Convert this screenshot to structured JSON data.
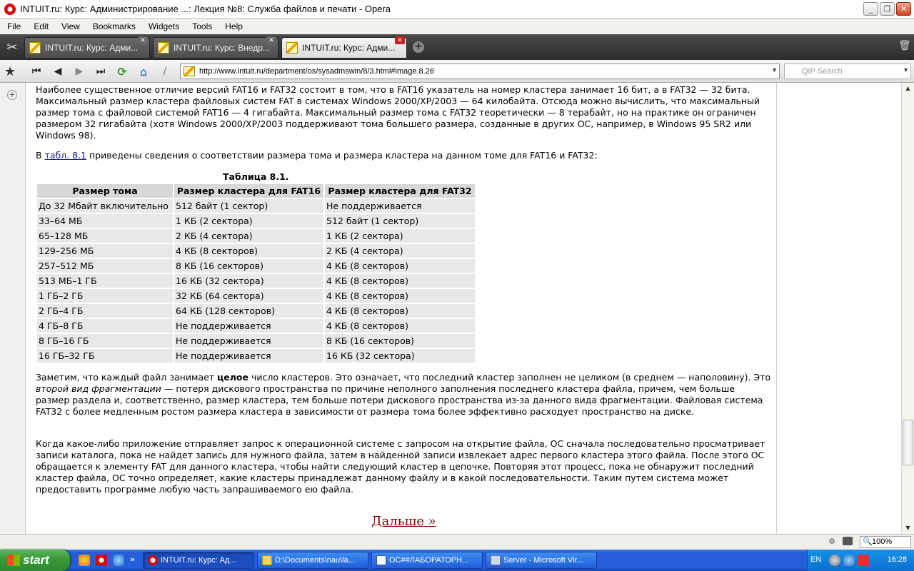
{
  "window": {
    "title": "INTUIT.ru: Курс: Администрирование ...: Лекция №8: Служба файлов и печати - Opera",
    "minimize_glyph": "_",
    "maximize_glyph": "❐",
    "close_glyph": "✕"
  },
  "menu": [
    "File",
    "Edit",
    "View",
    "Bookmarks",
    "Widgets",
    "Tools",
    "Help"
  ],
  "tabs": [
    {
      "label": "INTUIT.ru: Курс: Адми...",
      "active": false
    },
    {
      "label": "INTUIT.ru: Курс: Внедр...",
      "active": false
    },
    {
      "label": "INTUIT.ru: Курс: Адми...",
      "active": true
    }
  ],
  "nav": {
    "url": "http://www.intuit.ru/department/os/sysadmswin/8/3.html#image.8.26",
    "search_placeholder": "QIP Search"
  },
  "article": {
    "para1": "Наиболее существенное отличие версий FAT16 и FAT32 состоит в том, что в FAT16 указатель на номер кластера занимает 16 бит, а в FAT32 — 32 бита. Максимальный размер кластера файловых систем FAT в системах Windows 2000/XP/2003 — 64 килобайта. Отсюда можно вычислить, что максимальный размер тома с файловой системой FAT16 — 4 гигабайта. Максимальный размер тома с FAT32 теоретически — 8 терабайт, но на практике он ограничен размером 32 гигабайта (хотя Windows 2000/XP/2003 поддерживают тома большего размера, созданные в других ОС, например, в Windows 95 SR2 или Windows 98).",
    "para2_prefix": "В ",
    "para2_link": "табл. 8.1",
    "para2_suffix": " приведены сведения о соответствии размера тома и размера кластера на данном томе для FAT16 и FAT32:",
    "table_caption": "Таблица 8.1.",
    "table_headers": [
      "Размер тома",
      "Размер кластера для FAT16",
      "Размер кластера для FAT32"
    ],
    "table_rows": [
      [
        "До 32 Мбайт включительно",
        "512 байт (1 сектор)",
        "Не поддерживается"
      ],
      [
        "33–64 МБ",
        "1 КБ (2 сектора)",
        "512 байт (1 сектор)"
      ],
      [
        "65–128 МБ",
        "2 КБ (4 сектора)",
        "1 КБ (2 сектора)"
      ],
      [
        "129–256 МБ",
        "4 КБ (8 секторов)",
        "2 КБ (4 сектора)"
      ],
      [
        "257–512 МБ",
        "8 КБ (16 секторов)",
        "4 КБ (8 секторов)"
      ],
      [
        "513 МБ–1 ГБ",
        "16 КБ (32 сектора)",
        "4 КБ (8 секторов)"
      ],
      [
        "1 ГБ–2 ГБ",
        "32 КБ (64 сектора)",
        "4 КБ (8 секторов)"
      ],
      [
        "2 ГБ–4 ГБ",
        "64 КБ (128 секторов)",
        "4 КБ (8 секторов)"
      ],
      [
        "4 ГБ–8 ГБ",
        "Не поддерживается",
        "4 КБ (8 секторов)"
      ],
      [
        "8 ГБ–16 ГБ",
        "Не поддерживается",
        "8 КБ (16 секторов)"
      ],
      [
        "16 ГБ–32 ГБ",
        "Не поддерживается",
        "16 КБ (32 сектора)"
      ]
    ],
    "para3_a": "Заметим, что каждый файл занимает ",
    "para3_bold": "целое",
    "para3_b": " число кластеров. Это означает, что последний кластер заполнен не целиком (в среднем — наполовину). Это ",
    "para3_italic": "второй вид фрагментации",
    "para3_c": " — потеря дискового пространства по причине неполного заполнения последнего кластера файла, причем, чем больше размер раздела и, соответственно, размер кластера, тем больше потери дискового пространства из-за данного вида фрагментации. Файловая система FAT32 с более медленным ростом размера кластера в зависимости от размера тома более эффективно расходует пространство на диске.",
    "para4": "Когда какое-либо приложение отправляет запрос к операционной системе с запросом на открытие файла, ОС сначала последовательно просматривает записи каталога, пока не найдет запись для нужного файла, затем в найденной записи извлекает адрес первого кластера этого файла. После этого ОС обращается к элементу FAT для данного кластера, чтобы найти следующий кластер в цепочке. Повторяя этот процесс, пока не обнаружит последний кластер файла, ОС точно определяет, какие кластеры принадлежат данному файлу и в какой последовательности. Таким путем система может предоставить программе любую часть запрашиваемого ею файла.",
    "next_link": "Дальше »"
  },
  "scrollbar": {
    "position_fraction": 0.85
  },
  "status": {
    "zoom": "100%"
  },
  "taskbar": {
    "start_label": "start",
    "quick_more": "»",
    "tasks": [
      {
        "label": "INTUIT.ru: Курс: Ад...",
        "active": true
      },
      {
        "label": "D:\\Documents\\nau\\la...",
        "active": false
      },
      {
        "label": "ОС##ЛАБОРАТОРН...",
        "active": false
      },
      {
        "label": "Server - Microsoft Vir...",
        "active": false
      }
    ],
    "language": "EN",
    "clock": "16:28"
  },
  "colors": {
    "link": "#1a1a9a",
    "next_link": "#8b0000",
    "taskbar_blue": "#245edb",
    "start_green": "#3c9a3c"
  }
}
